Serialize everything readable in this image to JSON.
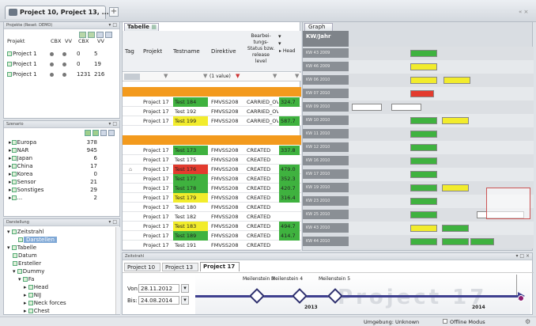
{
  "app": {
    "tab_title": "Project 10, Project 13, ...",
    "close_glyph": "×",
    "add_glyph": "+",
    "window_controls": "« ×"
  },
  "projects_panel": {
    "title": "Projekte (Reset: DEMO)",
    "headers": [
      "Projekt",
      "CBX",
      "VV",
      "CBX",
      "VV"
    ],
    "rows": [
      {
        "name": "Project 1",
        "a": "0",
        "b": "5"
      },
      {
        "name": "Project 1",
        "a": "0",
        "b": "19"
      },
      {
        "name": "Project 1",
        "a": "1231",
        "b": "216"
      }
    ]
  },
  "szenario_panel": {
    "title": "Szenario",
    "rows": [
      {
        "label": "Europa",
        "value": "378"
      },
      {
        "label": "NAR",
        "value": "945"
      },
      {
        "label": "Japan",
        "value": "6"
      },
      {
        "label": "China",
        "value": "17"
      },
      {
        "label": "Korea",
        "value": "0"
      },
      {
        "label": "Sensor",
        "value": "21"
      },
      {
        "label": "Sonstiges",
        "value": "29"
      },
      {
        "label": "...",
        "value": "2"
      }
    ]
  },
  "darstellung_panel": {
    "title": "Darstellung",
    "items": [
      "Zeitstrahl",
      "Darstellen",
      "Tabelle",
      "Datum",
      "Ersteller",
      "Dummy",
      "Fa",
      "Head",
      "NIJ",
      "Neck forces",
      "Chest"
    ]
  },
  "tabelle": {
    "tab_label": "Tabelle",
    "headers": [
      "Tag",
      "Projekt",
      "Testname",
      "Direktive",
      "Bearbei-tungs-Status bzw. release level",
      "Head"
    ],
    "filter_text": "(1 value)",
    "rows": [
      {
        "projekt": "Project 17",
        "test": "Test 184",
        "dir": "FMVSS208",
        "status": "CARRIED_OV",
        "val": "324.7",
        "tcol": "green",
        "vcol": "green"
      },
      {
        "projekt": "Project 17",
        "test": "Test 192",
        "dir": "FMVSS208",
        "status": "CARRIED_OV",
        "val": "",
        "tcol": "",
        "vcol": ""
      },
      {
        "projekt": "Project 17",
        "test": "Test 199",
        "dir": "FMVSS208",
        "status": "CARRIED_OV",
        "val": "587.7",
        "tcol": "yellow",
        "vcol": "green"
      },
      {
        "projekt": "Project 17",
        "test": "Test 173",
        "dir": "FMVSS208",
        "status": "CREATED",
        "val": "337.8",
        "tcol": "green",
        "vcol": "green"
      },
      {
        "projekt": "Project 17",
        "test": "Test 175",
        "dir": "FMVSS208",
        "status": "CREATED",
        "val": "",
        "tcol": "",
        "vcol": ""
      },
      {
        "projekt": "Project 17",
        "test": "Test 176",
        "dir": "FMVSS208",
        "status": "CREATED",
        "val": "479.0",
        "tcol": "red",
        "vcol": "green"
      },
      {
        "projekt": "Project 17",
        "test": "Test 177",
        "dir": "FMVSS208",
        "status": "CREATED",
        "val": "352.3",
        "tcol": "green",
        "vcol": "green"
      },
      {
        "projekt": "Project 17",
        "test": "Test 178",
        "dir": "FMVSS208",
        "status": "CREATED",
        "val": "420.7",
        "tcol": "green",
        "vcol": "green"
      },
      {
        "projekt": "Project 17",
        "test": "Test 179",
        "dir": "FMVSS208",
        "status": "CREATED",
        "val": "316.4",
        "tcol": "yellow",
        "vcol": "green"
      },
      {
        "projekt": "Project 17",
        "test": "Test 180",
        "dir": "FMVSS208",
        "status": "CREATED",
        "val": "",
        "tcol": "",
        "vcol": ""
      },
      {
        "projekt": "Project 17",
        "test": "Test 182",
        "dir": "FMVSS208",
        "status": "CREATED",
        "val": "",
        "tcol": "",
        "vcol": ""
      },
      {
        "projekt": "Project 17",
        "test": "Test 183",
        "dir": "FMVSS208",
        "status": "CREATED",
        "val": "494.7",
        "tcol": "yellow",
        "vcol": "green"
      },
      {
        "projekt": "Project 17",
        "test": "Test 189",
        "dir": "FMVSS208",
        "status": "CREATED",
        "val": "414.7",
        "tcol": "green",
        "vcol": "green"
      },
      {
        "projekt": "Project 17",
        "test": "Test 191",
        "dir": "FMVSS208",
        "status": "CREATED",
        "val": "",
        "tcol": "",
        "vcol": ""
      }
    ]
  },
  "graph": {
    "tab_label": "Graph",
    "header": "KW/Jahr",
    "weeks": [
      "KW 43 2009",
      "KW 46 2009",
      "KW 06 2010",
      "KW 07 2010",
      "KW 09 2010",
      "KW 10 2010",
      "KW 11 2010",
      "KW 12 2010",
      "KW 16 2010",
      "KW 17 2010",
      "KW 19 2010",
      "KW 23 2010",
      "KW 25 2010",
      "KW 43 2010",
      "KW 44 2010"
    ]
  },
  "zeitstrahl": {
    "title": "Zeitstrahl",
    "tabs": [
      "Project 10",
      "Project 13",
      "Project 17"
    ],
    "von_label": "Von:",
    "von_value": "28.11.2012",
    "bis_label": "Bis:",
    "bis_value": "24.08.2014",
    "milestones": [
      "Meilenstein 3",
      "Meilenstein 4",
      "Meilenstein 5"
    ],
    "watermark": "Project 17",
    "years": [
      "2013",
      "2014"
    ]
  },
  "statusbar": {
    "umgebung": "Umgebung: Unknown",
    "offline": "Offline Modus"
  },
  "colors": {
    "green": "#3fb23f",
    "yellow": "#f2ec2c",
    "red": "#e33b2e",
    "orange": "#f39a1d",
    "timeline": "#3e3f8f"
  }
}
